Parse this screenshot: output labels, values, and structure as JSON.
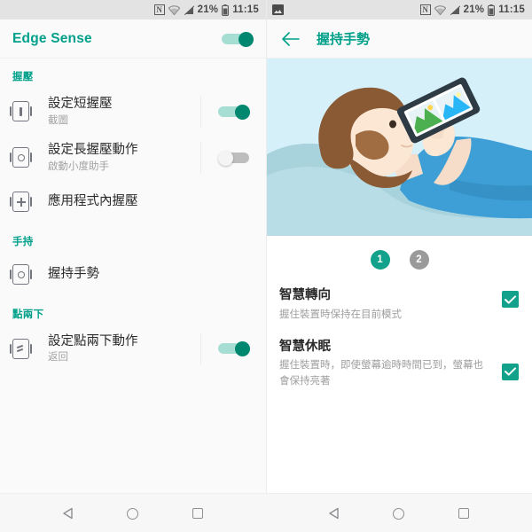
{
  "status_bar": {
    "left_icons_right_pane": [
      "photo-notification-icon"
    ],
    "icons": [
      "nfc-icon",
      "wifi-icon",
      "signal-off-icon",
      "battery-icon"
    ],
    "nfc_label": "N",
    "battery_percent": "21%",
    "time": "11:15"
  },
  "left_pane": {
    "app_title": "Edge Sense",
    "master_toggle": {
      "name": "edge-sense-master-toggle",
      "state": "on"
    },
    "sections": [
      {
        "header": "握壓",
        "rows": [
          {
            "icon": "phone-squeeze-short-icon",
            "title": "設定短握壓",
            "subtitle": "截圖",
            "toggle": "on"
          },
          {
            "icon": "phone-squeeze-long-icon",
            "title": "設定長握壓動作",
            "subtitle": "啟動小度助手",
            "toggle": "off"
          },
          {
            "icon": "phone-in-app-squeeze-icon",
            "title": "應用程式內握壓",
            "subtitle": "",
            "toggle": "none"
          }
        ]
      },
      {
        "header": "手持",
        "rows": [
          {
            "icon": "phone-grip-gesture-icon",
            "title": "握持手勢",
            "subtitle": "",
            "toggle": "none"
          }
        ]
      },
      {
        "header": "點兩下",
        "rows": [
          {
            "icon": "phone-double-tap-icon",
            "title": "設定點兩下動作",
            "subtitle": "返回",
            "toggle": "on"
          }
        ]
      }
    ]
  },
  "right_pane": {
    "back_button": "back-arrow-icon",
    "page_title": "握持手勢",
    "illustration": "person-lying-in-bed-holding-phone",
    "pager": [
      {
        "label": "1",
        "state": "active"
      },
      {
        "label": "2",
        "state": "inactive"
      }
    ],
    "options": [
      {
        "title": "智慧轉向",
        "subtitle": "握住裝置時保持在目前模式",
        "checked": true
      },
      {
        "title": "智慧休眠",
        "subtitle": "握住裝置時，即使螢幕逾時時間已到，螢幕也會保持亮著",
        "checked": true
      }
    ]
  },
  "nav_bar": {
    "buttons": [
      "back-triangle-icon",
      "home-circle-icon",
      "recents-square-icon"
    ]
  },
  "colors": {
    "accent_teal": "#00a08a",
    "toggle_on": "#00876f",
    "checkbox_teal": "#12a18a",
    "illustration_sky": "#d6f0fa",
    "shirt_blue": "#3d9fd6",
    "hair_brown": "#8a5a35",
    "skin": "#f6ddc9",
    "blanket": "#a8d3dd"
  }
}
